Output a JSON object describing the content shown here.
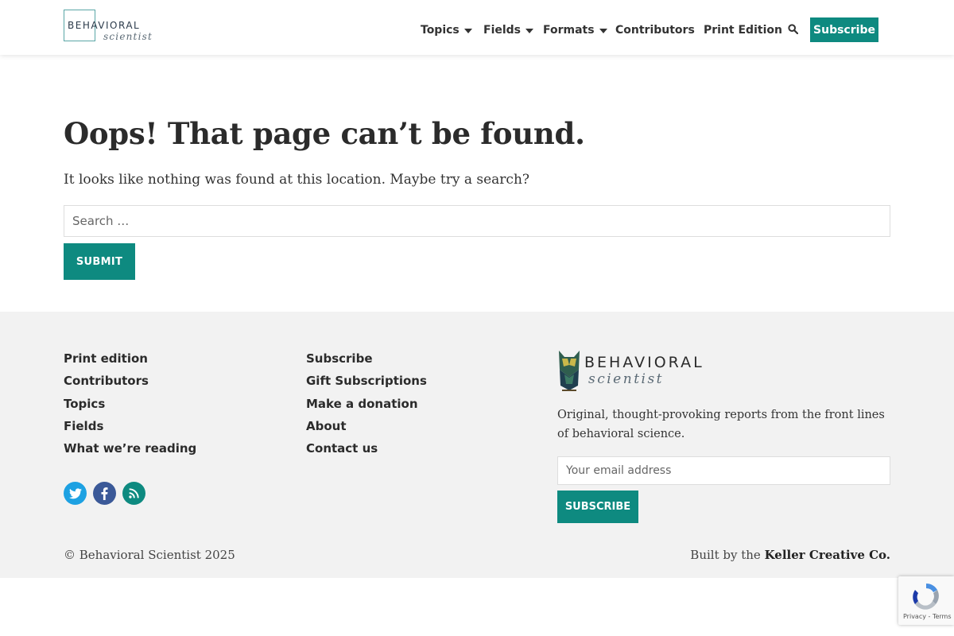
{
  "header": {
    "logo": {
      "line1": "BEHAVIORAL",
      "line2": "scientist"
    },
    "nav": [
      {
        "label": "Topics",
        "dropdown": true
      },
      {
        "label": "Fields",
        "dropdown": true
      },
      {
        "label": "Formats",
        "dropdown": true
      },
      {
        "label": "Contributors",
        "dropdown": false
      },
      {
        "label": "Print Edition",
        "dropdown": false
      }
    ],
    "search_icon": "search-icon",
    "subscribe_label": "Subscribe"
  },
  "main": {
    "title": "Oops! That page can’t be found.",
    "message": "It looks like nothing was found at this location. Maybe try a search?",
    "search": {
      "placeholder": "Search …",
      "value": ""
    },
    "submit_label": "SUBMIT"
  },
  "footer": {
    "col1": [
      "Print edition",
      "Contributors",
      "Topics",
      "Fields",
      "What we’re reading"
    ],
    "col2": [
      "Subscribe",
      "Gift Subscriptions",
      "Make a donation",
      "About",
      "Contact us"
    ],
    "social": [
      {
        "name": "twitter-icon",
        "color": "#1da1e2"
      },
      {
        "name": "facebook-icon",
        "color": "#3b5998"
      },
      {
        "name": "rss-icon",
        "color": "#0e8a80"
      }
    ],
    "brand": {
      "line1": "BEHAVIORAL",
      "line2": "scientist"
    },
    "tagline": "Original, thought-provoking reports from the front lines of behavioral science.",
    "email_placeholder": "Your email address",
    "subscribe_label": "SUBSCRIBE",
    "copyright": "© Behavioral Scientist 2025",
    "built_by_prefix": "Built by the ",
    "built_by_name": "Keller Creative Co."
  },
  "recaptcha": {
    "text": "Privacy - Terms"
  },
  "colors": {
    "accent": "#0e8a80",
    "footer_bg": "#f2f2f2"
  }
}
